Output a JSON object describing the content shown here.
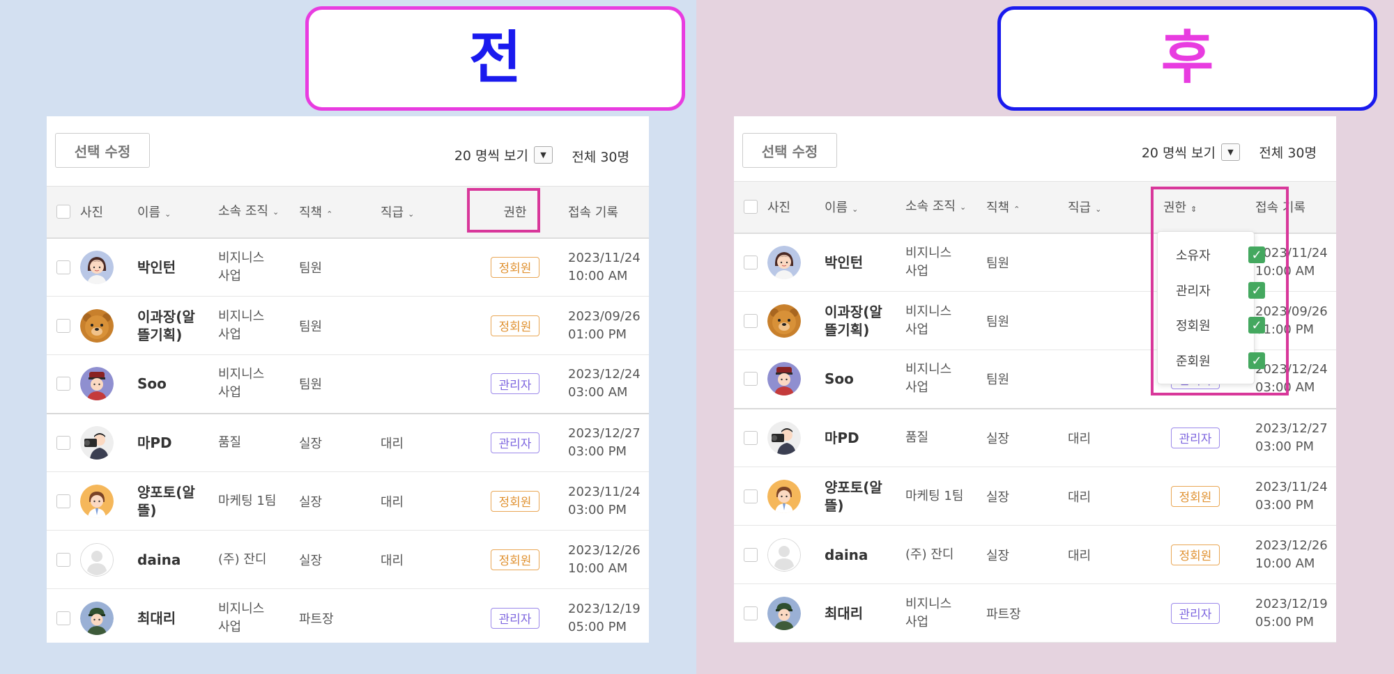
{
  "colors": {
    "left_bg": "#d3e0f1",
    "right_bg": "#e5d3df",
    "blue": "#1a1aee",
    "magenta": "#e83ce0",
    "gold_badge": "#e09130",
    "purple_badge": "#7e66df",
    "checked_green": "#44a85f",
    "highlight": "#d8379a"
  },
  "before": {
    "title": "전",
    "toolbar": {
      "edit_label": "선택 수정",
      "perpage_label": "20 명씩 보기",
      "total_label": "전체 30명"
    },
    "columns": {
      "photo": "사진",
      "name": "이름",
      "org": "소속 조직",
      "duty": "직책",
      "rank": "직급",
      "role": "권한",
      "access": "접속 기록"
    }
  },
  "after": {
    "title": "후",
    "toolbar": {
      "edit_label": "선택 수정",
      "perpage_label": "20 명씩 보기",
      "total_label": "전체 30명"
    },
    "columns": {
      "photo": "사진",
      "name": "이름",
      "org": "소속 조직",
      "duty": "직책",
      "rank": "직급",
      "role": "권한",
      "access": "접속 기록"
    },
    "role_filter": [
      {
        "label": "소유자",
        "checked": true
      },
      {
        "label": "관리자",
        "checked": true
      },
      {
        "label": "정회원",
        "checked": true
      },
      {
        "label": "준회원",
        "checked": true
      }
    ]
  },
  "rows": [
    {
      "avatar": "woman-avatar-icon",
      "name_lines": [
        "박인턴",
        ""
      ],
      "org_lines": [
        "비지니스",
        "사업"
      ],
      "duty": "팀원",
      "rank": "",
      "role": "정회원",
      "role_style": "gold",
      "date": "2023/11/24",
      "time": "10:00 AM"
    },
    {
      "avatar": "bear-avatar-icon",
      "name_lines": [
        "이과장(알",
        "뜰기획)"
      ],
      "org_lines": [
        "비지니스",
        "사업"
      ],
      "duty": "팀원",
      "rank": "",
      "role": "정회원",
      "role_style": "gold",
      "date": "2023/09/26",
      "time": "01:00 PM"
    },
    {
      "avatar": "guard-avatar-icon",
      "name_lines": [
        "Soo",
        ""
      ],
      "org_lines": [
        "비지니스",
        "사업"
      ],
      "duty": "팀원",
      "rank": "",
      "role": "관리자",
      "role_style": "purple",
      "date": "2023/12/24",
      "time": "03:00 AM"
    },
    {
      "avatar": "camera-man-avatar-icon",
      "name_lines": [
        "마PD",
        ""
      ],
      "org_lines": [
        "품질",
        ""
      ],
      "duty": "실장",
      "rank": "대리",
      "role": "관리자",
      "role_style": "purple",
      "date": "2023/12/27",
      "time": "03:00 PM"
    },
    {
      "avatar": "doctor-avatar-icon",
      "name_lines": [
        "양포토(알",
        "뜰)"
      ],
      "org_lines": [
        "마케팅 1팀",
        ""
      ],
      "duty": "실장",
      "rank": "대리",
      "role": "정회원",
      "role_style": "gold",
      "date": "2023/11/24",
      "time": "03:00 PM"
    },
    {
      "avatar": "default-avatar-icon",
      "name_lines": [
        "daina",
        ""
      ],
      "org_lines": [
        "(주) 잔디",
        ""
      ],
      "duty": "실장",
      "rank": "대리",
      "role": "정회원",
      "role_style": "gold",
      "date": "2023/12/26",
      "time": "10:00 AM"
    },
    {
      "avatar": "soldier-avatar-icon",
      "name_lines": [
        "최대리",
        ""
      ],
      "org_lines": [
        "비지니스",
        "사업"
      ],
      "duty": "파트장",
      "rank": "",
      "role": "관리자",
      "role_style": "purple",
      "date": "2023/12/19",
      "time": "05:00 PM"
    }
  ]
}
